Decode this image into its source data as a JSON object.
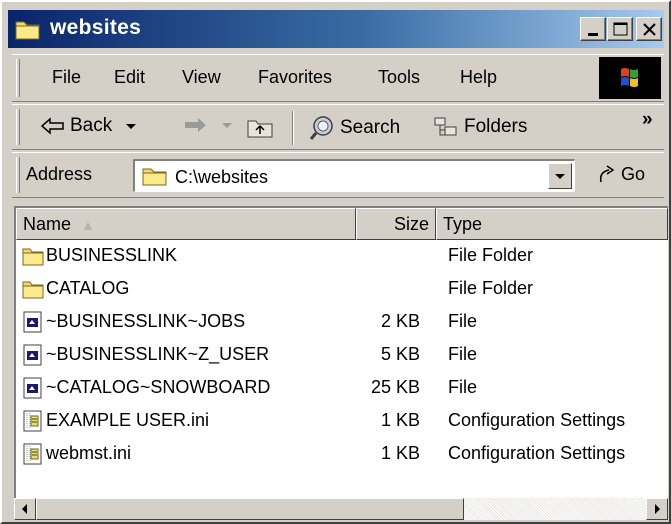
{
  "window": {
    "title": "websites",
    "title_gradient": [
      "#0a246a",
      "#a6caf0"
    ]
  },
  "menu": {
    "items": [
      {
        "label": "File",
        "icon": null
      },
      {
        "label": "Edit",
        "icon": null
      },
      {
        "label": "View",
        "icon": null
      },
      {
        "label": "Favorites",
        "icon": null
      },
      {
        "label": "Tools",
        "icon": null
      },
      {
        "label": "Help",
        "icon": null
      }
    ]
  },
  "toolbar": {
    "back_label": "Back",
    "search_label": "Search",
    "folders_label": "Folders",
    "more_glyph": "»"
  },
  "address": {
    "label": "Address",
    "value": "C:\\websites",
    "go_label": "Go"
  },
  "list": {
    "columns": {
      "name": "Name",
      "size": "Size",
      "type": "Type"
    },
    "rows": [
      {
        "name": "BUSINESSLINK",
        "size": "",
        "type": "File Folder",
        "icon": "folder-icon"
      },
      {
        "name": "CATALOG",
        "size": "",
        "type": "File Folder",
        "icon": "folder-icon"
      },
      {
        "name": "~BUSINESSLINK~JOBS",
        "size": "2 KB",
        "type": "File",
        "icon": "generic-file-icon"
      },
      {
        "name": "~BUSINESSLINK~Z_USER",
        "size": "5 KB",
        "type": "File",
        "icon": "generic-file-icon"
      },
      {
        "name": "~CATALOG~SNOWBOARD",
        "size": "25 KB",
        "type": "File",
        "icon": "generic-file-icon"
      },
      {
        "name": "EXAMPLE USER.ini",
        "size": "1 KB",
        "type": "Configuration Settings",
        "icon": "ini-file-icon"
      },
      {
        "name": "webmst.ini",
        "size": "1 KB",
        "type": "Configuration Settings",
        "icon": "ini-file-icon"
      }
    ]
  }
}
